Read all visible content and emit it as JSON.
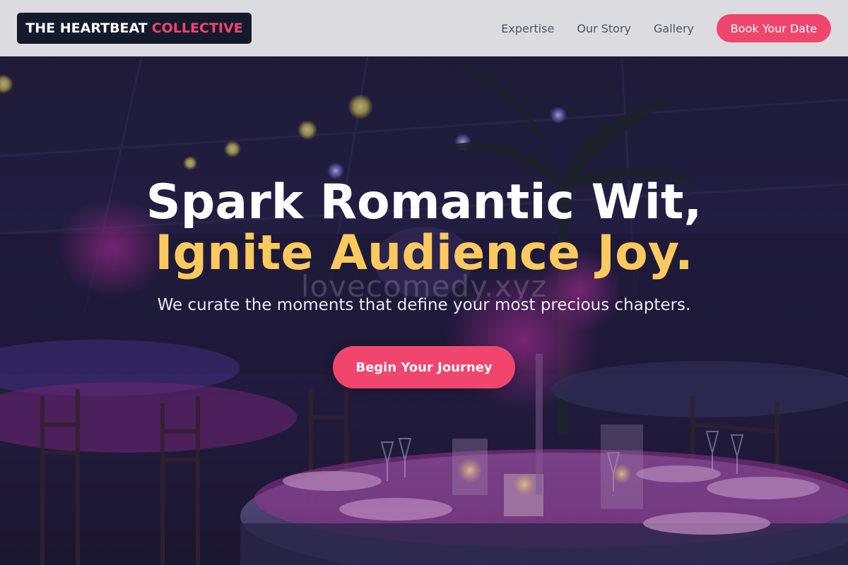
{
  "header": {
    "logo_main": "THE HEARTBEAT",
    "logo_accent": "COLLECTIVE",
    "nav": [
      "Expertise",
      "Our Story",
      "Gallery"
    ],
    "cta_label": "Book Your Date"
  },
  "hero": {
    "headline_line1": "Spark Romantic Wit,",
    "headline_line2": "Ignite Audience Joy.",
    "watermark": "lovecomedy.xyz",
    "subheadline": "We curate the moments that define your most precious chapters.",
    "cta_label": "Begin Your Journey",
    "background": "event-venue-photo"
  },
  "colors": {
    "accent": "#f0466e",
    "headline_highlight": "#fcc95f",
    "logo_bg": "#141a2c",
    "header_bg": "#dcdce0",
    "nav_text": "#4a5566"
  }
}
